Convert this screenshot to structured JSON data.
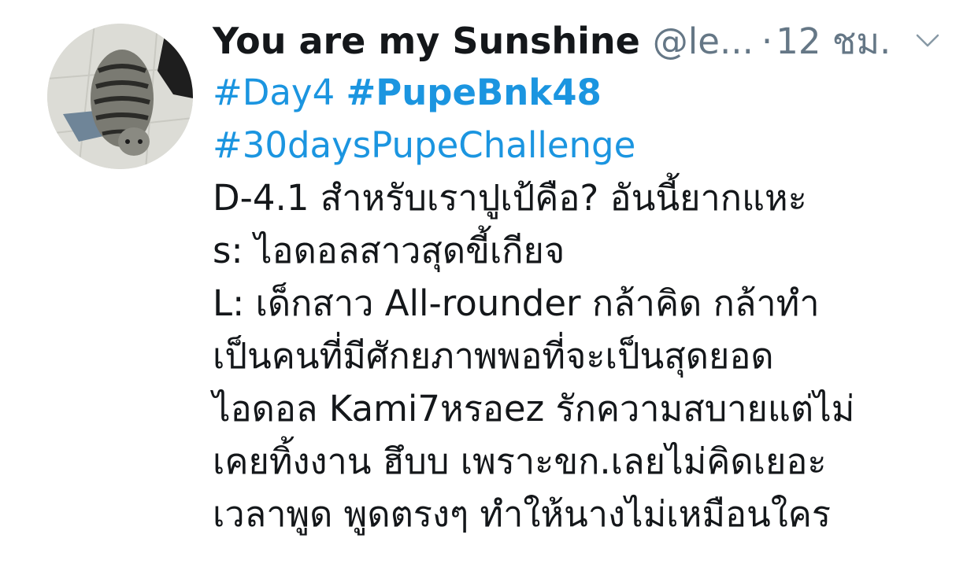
{
  "tweet": {
    "author_name": "You are my Sunshine",
    "author_handle": "@le...",
    "separator": "·",
    "timestamp": "12 ชม.",
    "hashtags": [
      "#Day4",
      "#PupeBnk48",
      "#30daysPupeChallenge"
    ],
    "lines": [
      "D-4.1 สำหรับเราปูเป้คือ? อันนี้ยากแหะ",
      "s: ไอดอลสาวสุดขี้เกียจ",
      "L: เด็กสาว All-rounder กล้าคิด กล้าทำ",
      "เป็นคนที่มีศักยภาพพอที่จะเป็นสุดยอด",
      "ไอดอล Kami7หรอez รักความสบายแต่ไม่",
      "เคยทิ้งงาน ฮึบบ เพราะขก.เลยไม่คิดเยอะ",
      "เวลาพูด พูดตรงๆ ทำให้นางไม่เหมือนใคร"
    ]
  },
  "icons": {
    "avatar": "cat-photo-avatar",
    "menu": "chevron-down-icon"
  },
  "colors": {
    "link": "#1b95e0",
    "text": "#14171a",
    "secondary": "#657786"
  }
}
